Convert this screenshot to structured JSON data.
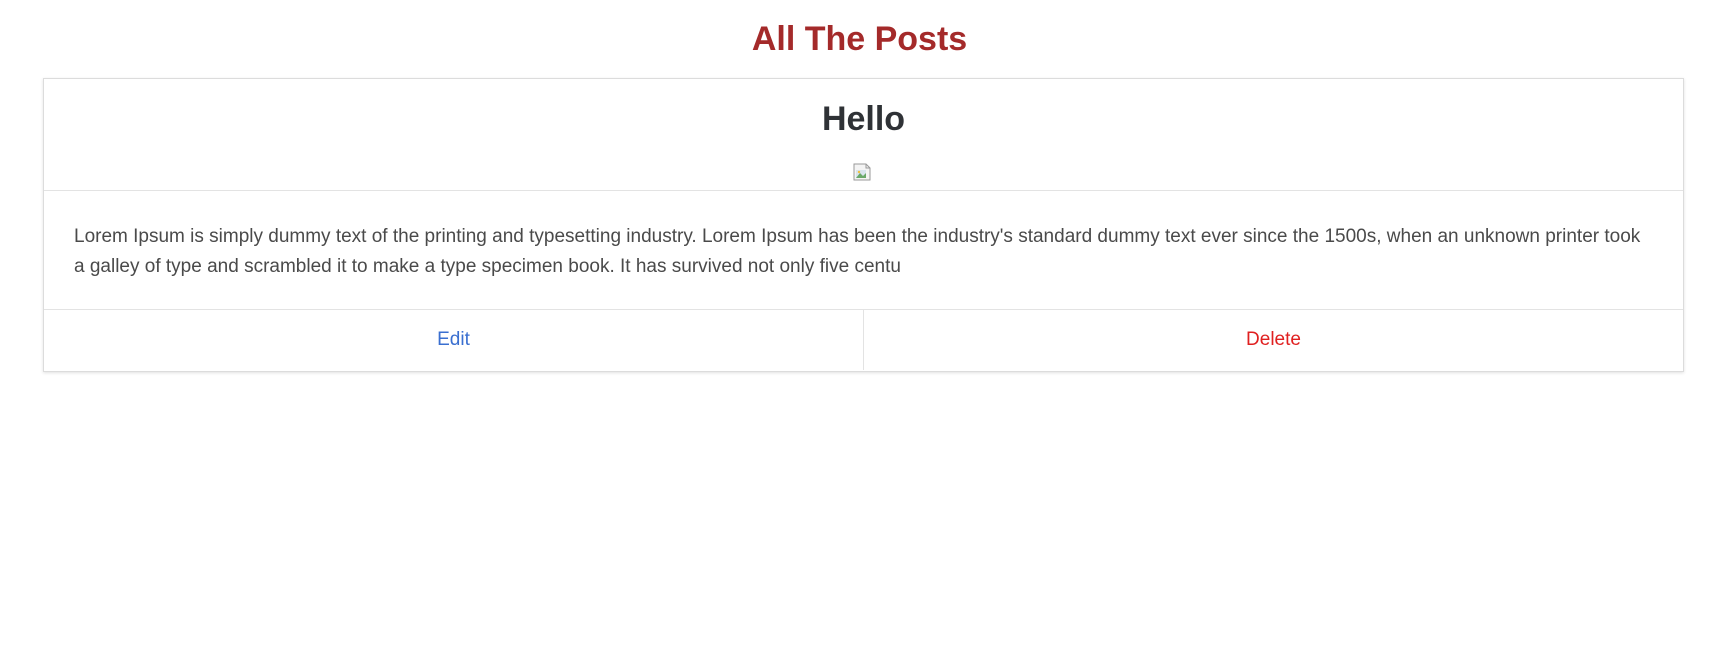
{
  "page": {
    "title": "All The Posts"
  },
  "post": {
    "title": "Hello",
    "image_icon": "broken-image-icon",
    "body": "Lorem Ipsum is simply dummy text of the printing and typesetting industry. Lorem Ipsum has been the industry's standard dummy text ever since the 1500s, when an unknown printer took a galley of type and scrambled it to make a type specimen book. It has survived not only five centu",
    "edit_label": "Edit",
    "delete_label": "Delete"
  },
  "colors": {
    "title": "#a42a2a",
    "edit": "#3a6fd0",
    "delete": "#e02020",
    "border": "#dcdcdc"
  }
}
